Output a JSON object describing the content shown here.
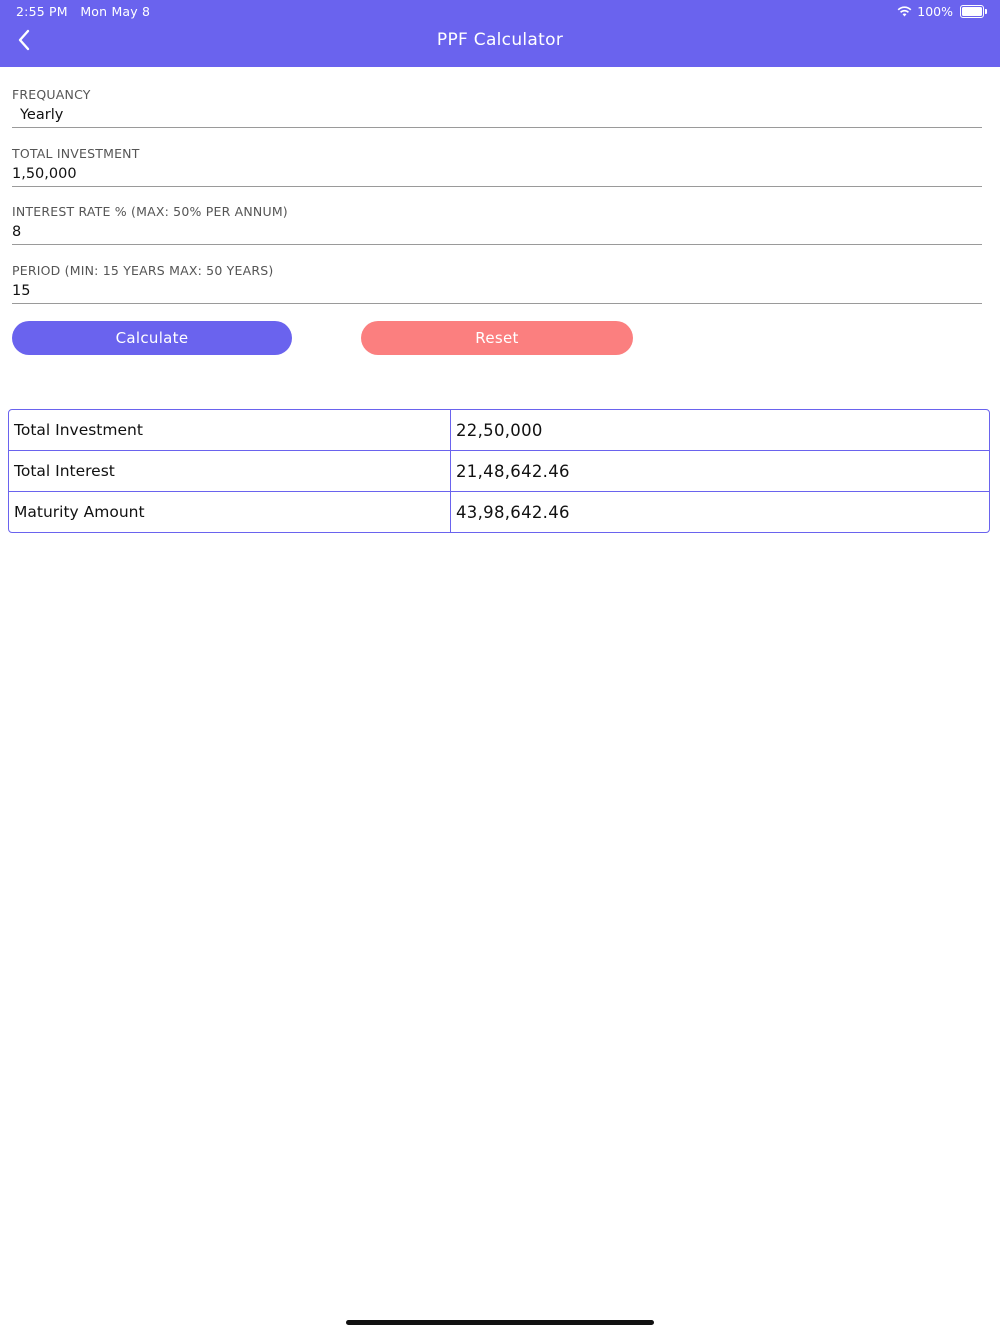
{
  "status_bar": {
    "time": "2:55 PM",
    "date": "Mon May 8",
    "battery": "100%"
  },
  "header": {
    "title": "PPF Calculator"
  },
  "form": {
    "frequency": {
      "label": "FREQUANCY",
      "value": "Yearly"
    },
    "total_investment": {
      "label": "TOTAL INVESTMENT",
      "value": "1,50,000"
    },
    "interest_rate": {
      "label": "INTEREST RATE % (MAX: 50% PER ANNUM)",
      "value": "8"
    },
    "period": {
      "label": "PERIOD (MIN: 15 YEARS MAX: 50 YEARS)",
      "value": "15"
    }
  },
  "buttons": {
    "calculate": "Calculate",
    "reset": "Reset"
  },
  "results": [
    {
      "label": "Total Investment",
      "value": "22,50,000"
    },
    {
      "label": "Total Interest",
      "value": "21,48,642.46"
    },
    {
      "label": "Maturity Amount",
      "value": "43,98,642.46"
    }
  ],
  "colors": {
    "primary": "#6a63ee",
    "reset": "#fb7f7f"
  }
}
